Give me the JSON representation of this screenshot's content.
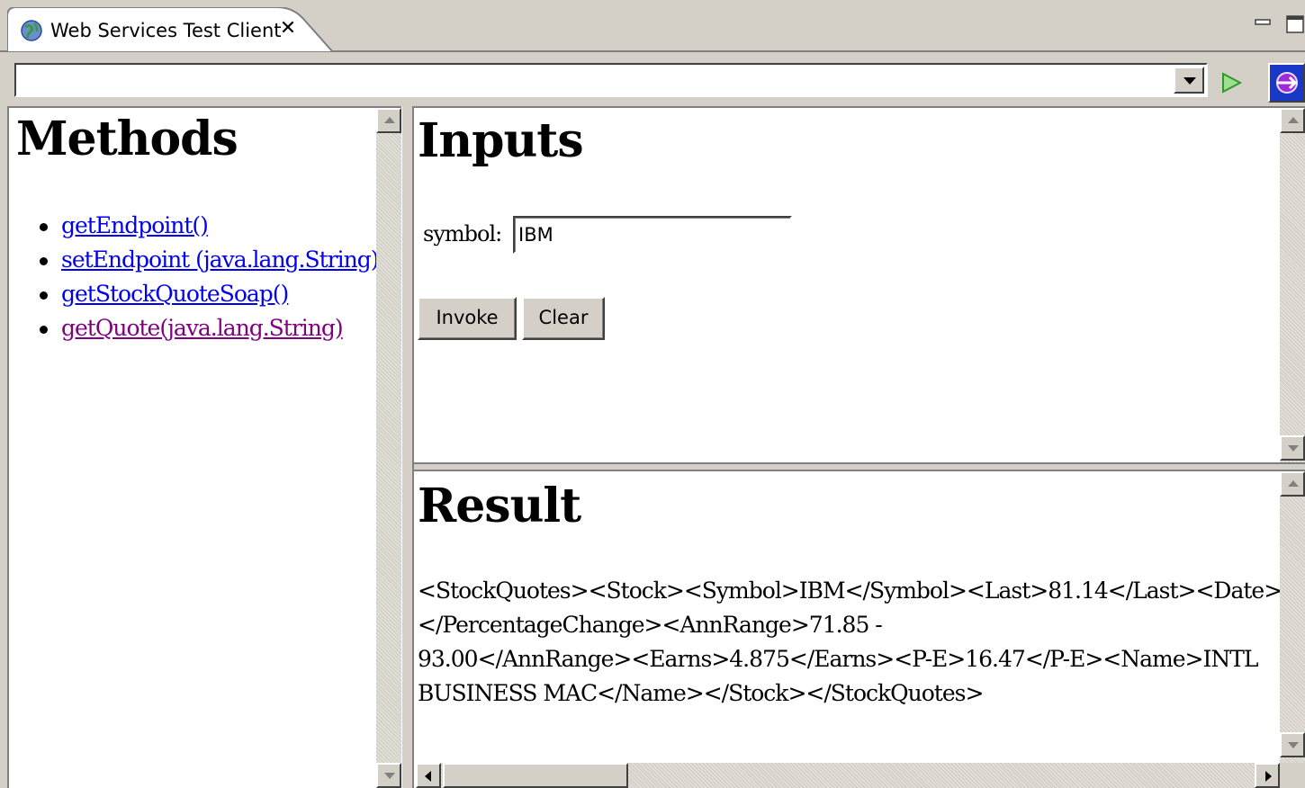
{
  "tab": {
    "title": "Web Services Test Client",
    "close_glyph": "✕",
    "icon": "globe-icon"
  },
  "window_controls": {
    "minimize_icon": "minimize-icon",
    "maximize_icon": "maximize-icon"
  },
  "toolbar": {
    "url_value": "",
    "go_icon": "go-arrow-icon",
    "browser_icon": "browser-icon"
  },
  "methods": {
    "title": "Methods",
    "items": [
      {
        "label": "getEndpoint()",
        "visited": false
      },
      {
        "label": "setEndpoint (java.lang.String)",
        "visited": false
      },
      {
        "label": "getStockQuoteSoap()",
        "visited": false
      },
      {
        "label": "getQuote(java.lang.String)",
        "visited": true
      }
    ]
  },
  "inputs": {
    "title": "Inputs",
    "symbol_label": "symbol:",
    "symbol_value": "IBM",
    "invoke_label": "Invoke",
    "clear_label": "Clear"
  },
  "result": {
    "title": "Result",
    "lines": [
      "<StockQuotes><Stock><Symbol>IBM</Symbol><Last>81.14</Last><Date>",
      "</PercentageChange><AnnRange>71.85 -",
      "93.00</AnnRange><Earns>4.875</Earns><P-E>16.47</P-E><Name>INTL",
      "BUSINESS MAC</Name></Stock></StockQuotes>"
    ]
  },
  "colors": {
    "link": "#0000ee",
    "visited_link": "#800080",
    "chrome": "#d4d0c8",
    "browser_button": "#1a38c8"
  }
}
